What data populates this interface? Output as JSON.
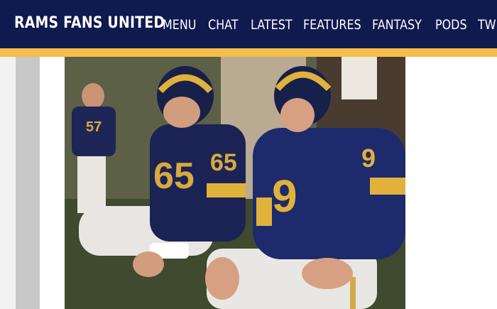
{
  "header": {
    "brand": "RAMS FANS UNITED",
    "nav": [
      "MENU",
      "CHAT",
      "LATEST",
      "FEATURES",
      "FANTASY",
      "PODS",
      "TW"
    ]
  },
  "article": {
    "photo": {
      "jersey_numbers": [
        "57",
        "65",
        "65",
        "9",
        "9"
      ]
    }
  },
  "colors": {
    "header_bg": "#0f1a4e",
    "accent": "#f6bd4b"
  }
}
